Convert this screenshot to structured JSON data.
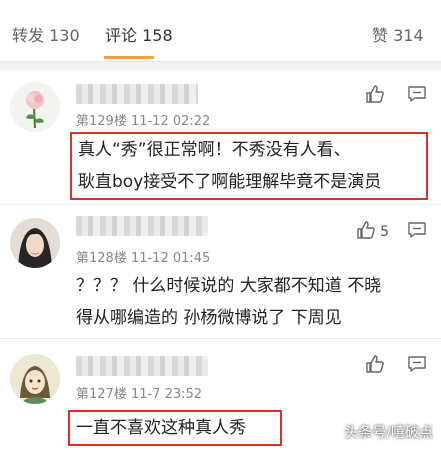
{
  "tabs": [
    {
      "label": "转发 130"
    },
    {
      "label": "评论 158"
    },
    {
      "label": "赞 314"
    }
  ],
  "comments": [
    {
      "meta": "第129楼 11-12 02:22",
      "likes": "",
      "lines": [
        "真人“秀”很正常啊！不秀没有人看、",
        "耿直boy接受不了啊能理解毕竟不是演员"
      ]
    },
    {
      "meta": "第128楼 11-12 01:45",
      "likes": "5",
      "lines": [
        "？？？ 什么时候说的 大家都不知道 不晓",
        "得从哪编造的 孙杨微博说了 下周见"
      ]
    },
    {
      "meta": "第127楼 11-7 23:52",
      "likes": "",
      "lines": [
        "一直不喜欢这种真人秀"
      ]
    }
  ],
  "watermark": "头条号/嘻破点",
  "colors": {
    "accent": "#f7a13a",
    "highlight_box": "#d9302a"
  },
  "icons": {
    "like": "thumbs-up-icon",
    "reply": "comment-icon"
  }
}
